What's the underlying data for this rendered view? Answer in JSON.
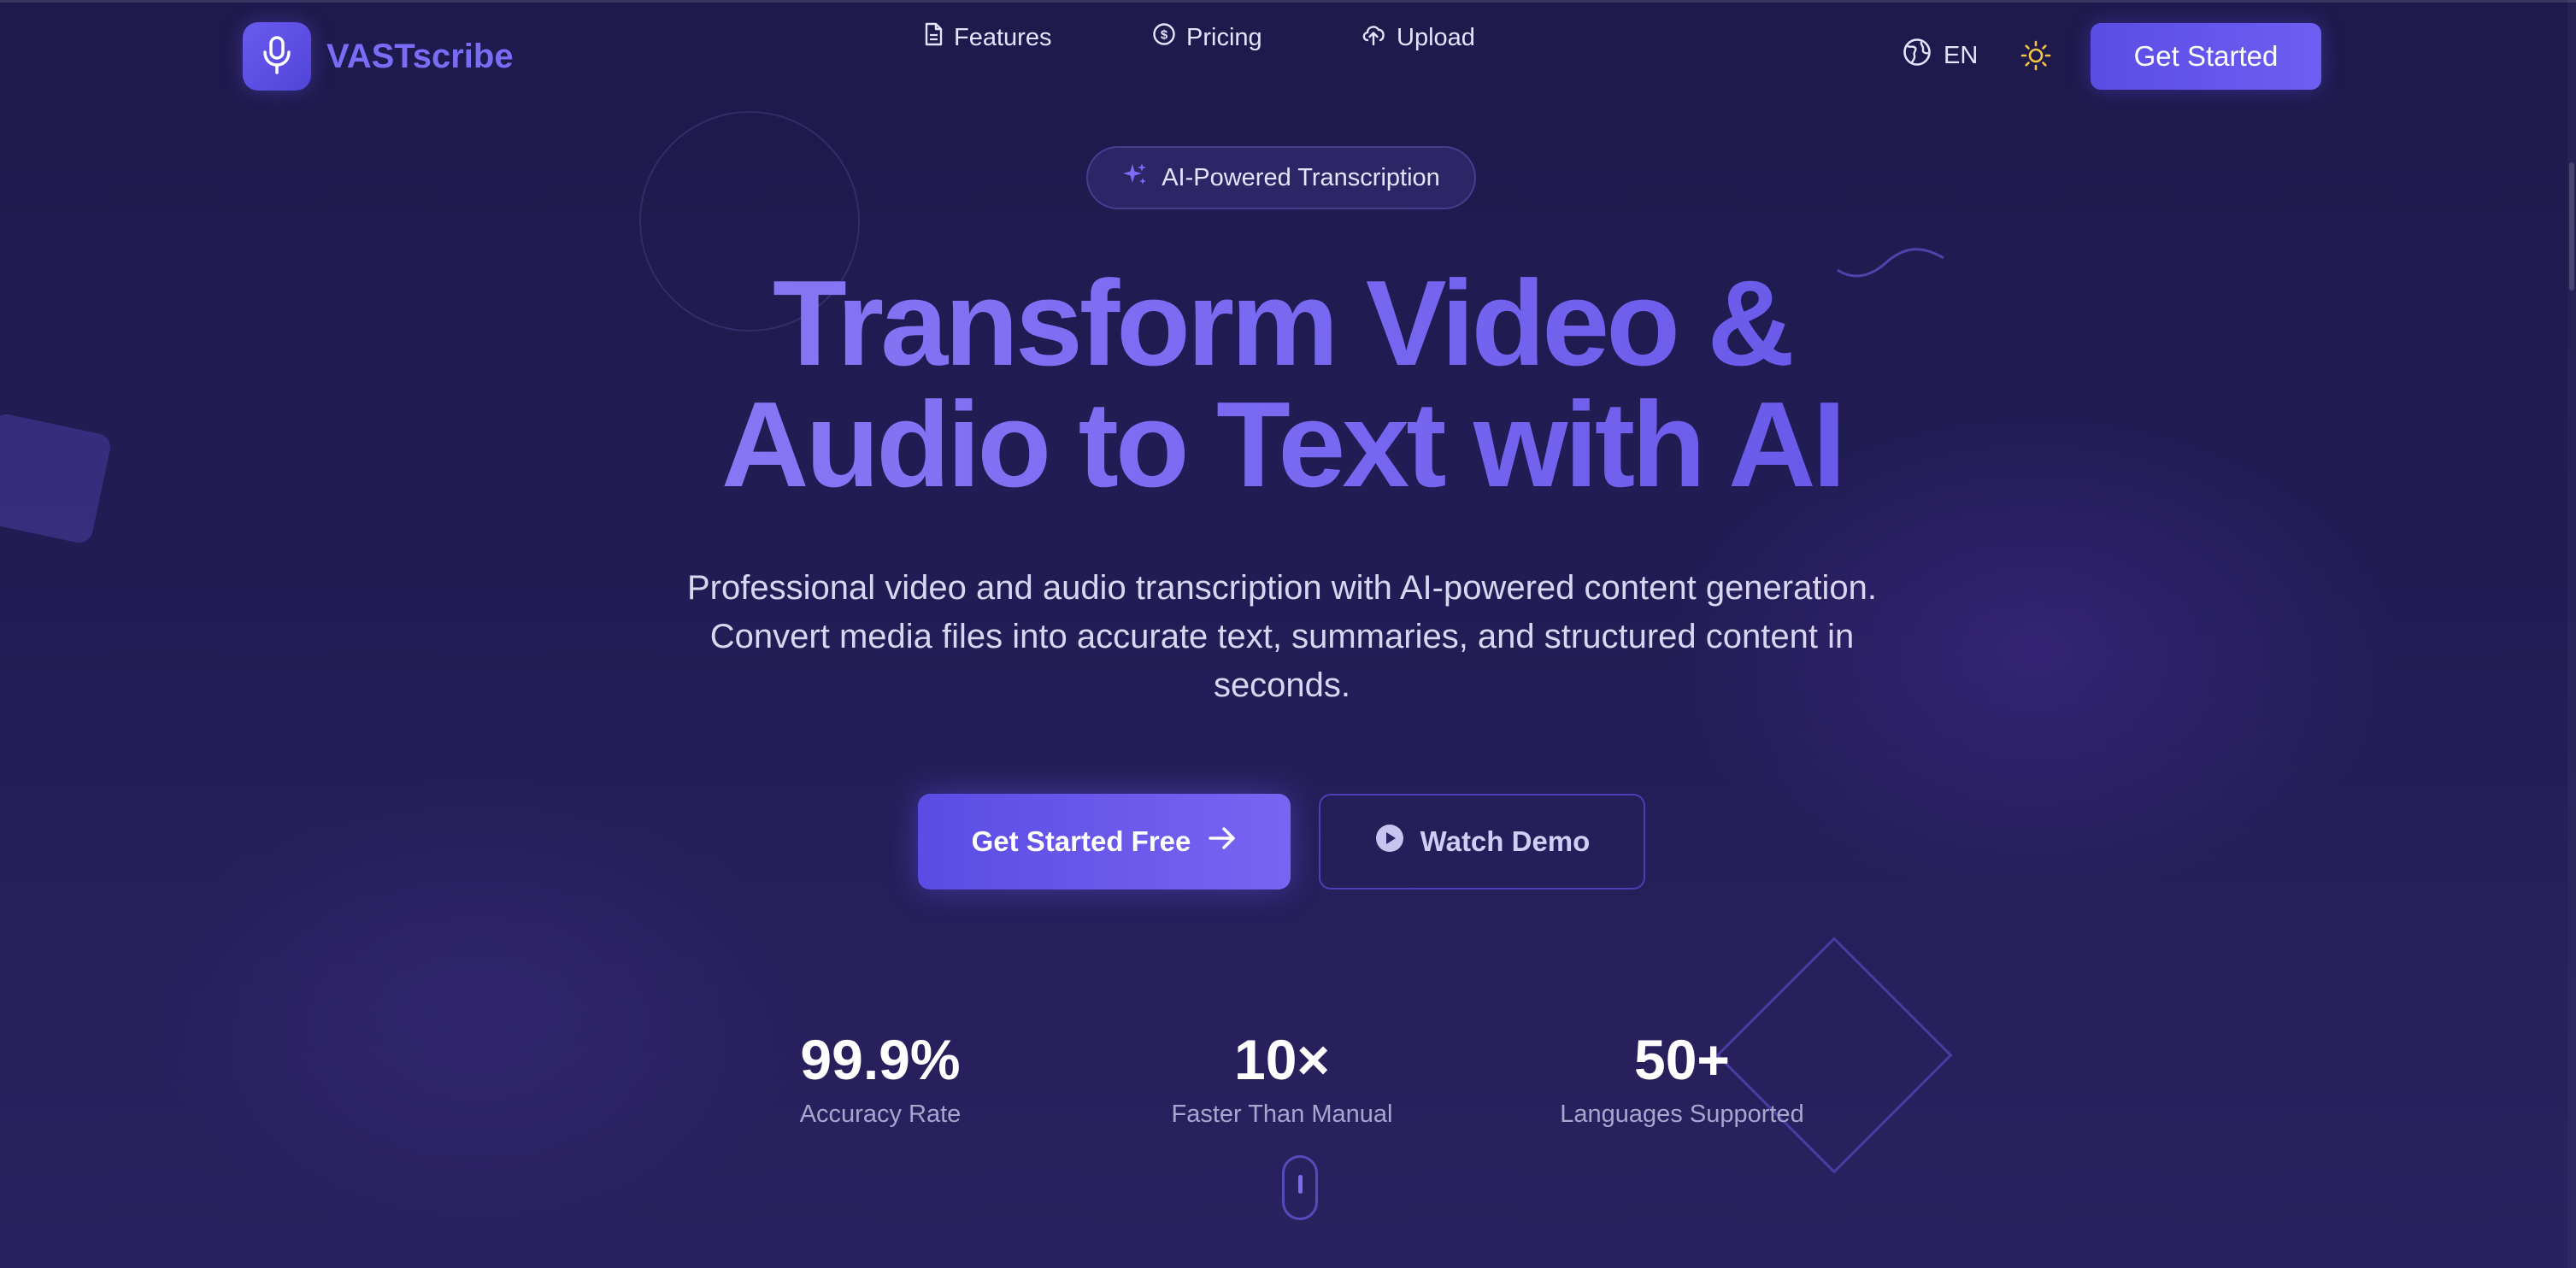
{
  "brand": {
    "name": "VASTscribe",
    "logo_icon": "microphone-icon",
    "accent_color": "#6a5bf0"
  },
  "nav": {
    "items": [
      {
        "label": "Features",
        "icon": "document-icon"
      },
      {
        "label": "Pricing",
        "icon": "dollar-circle-icon"
      },
      {
        "label": "Upload",
        "icon": "cloud-upload-icon"
      }
    ],
    "language": {
      "label": "EN",
      "icon": "globe-icon"
    },
    "theme_icon": "sun-icon",
    "cta_label": "Get Started"
  },
  "hero": {
    "badge": {
      "label": "AI-Powered Transcription",
      "icon": "sparkles-icon"
    },
    "title_line1": "Transform Video &",
    "title_line2": "Audio to Text with AI",
    "subtitle_line1": "Professional video and audio transcription with AI-powered content generation.",
    "subtitle_line2": "Convert media files into accurate text, summaries, and structured content in",
    "subtitle_line3": "seconds.",
    "primary_cta": {
      "label": "Get Started Free",
      "icon": "arrow-right-icon"
    },
    "secondary_cta": {
      "label": "Watch Demo",
      "icon": "play-circle-icon"
    }
  },
  "stats": [
    {
      "value": "99.9%",
      "label": "Accuracy Rate"
    },
    {
      "value": "10×",
      "label": "Faster Than Manual"
    },
    {
      "value": "50+",
      "label": "Languages Supported"
    }
  ],
  "colors": {
    "background": "#221c55",
    "primary_button": "#5b4ce6",
    "theme_icon": "#f5c542",
    "text_muted": "#a9a5cf"
  }
}
